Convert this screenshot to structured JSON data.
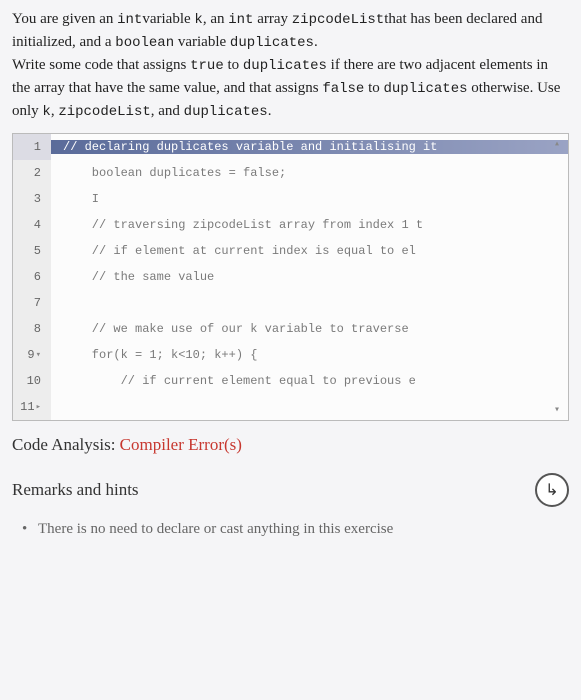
{
  "problem": {
    "sentence1_pre": "You are given an ",
    "sentence1_var1": "int",
    "sentence1_mid1": "variable ",
    "sentence1_var2": "k",
    "sentence1_mid2": ", an ",
    "sentence1_var3": "int",
    "sentence1_mid3": " array ",
    "sentence1_var4": "zipcodeList",
    "sentence1_mid4": "that has been declared and initialized, and a ",
    "sentence1_var5": "boolean",
    "sentence1_mid5": " variable ",
    "sentence1_var6": "duplicates",
    "sentence1_end": ".",
    "sentence2_pre": "Write some code that assigns ",
    "sentence2_var1": "true",
    "sentence2_mid1": " to ",
    "sentence2_var2": "duplicates",
    "sentence2_mid2": " if there are two adjacent elements in the array that have the same value, and that assigns ",
    "sentence2_var3": "false",
    "sentence2_mid3": " to ",
    "sentence2_var4": "duplicates",
    "sentence2_mid4": " otherwise. Use only ",
    "sentence2_var5": "k",
    "sentence2_mid5": ", ",
    "sentence2_var6": "zipcodeList",
    "sentence2_mid6": ", and ",
    "sentence2_var7": "duplicates",
    "sentence2_end": "."
  },
  "code": {
    "lines": [
      {
        "num": "1",
        "text": "// declaring duplicates variable and initialising it",
        "highlight": true,
        "collapse": ""
      },
      {
        "num": "2",
        "text": "    boolean duplicates = false;",
        "highlight": false,
        "collapse": ""
      },
      {
        "num": "3",
        "text": "    I",
        "highlight": false,
        "collapse": ""
      },
      {
        "num": "4",
        "text": "    // traversing zipcodeList array from index 1 t",
        "highlight": false,
        "collapse": ""
      },
      {
        "num": "5",
        "text": "    // if element at current index is equal to el",
        "highlight": false,
        "collapse": ""
      },
      {
        "num": "6",
        "text": "    // the same value",
        "highlight": false,
        "collapse": ""
      },
      {
        "num": "7",
        "text": "",
        "highlight": false,
        "collapse": ""
      },
      {
        "num": "8",
        "text": "    // we make use of our k variable to traverse",
        "highlight": false,
        "collapse": ""
      },
      {
        "num": "9",
        "text": "    for(k = 1; k<10; k++) {",
        "highlight": false,
        "collapse": "▾"
      },
      {
        "num": "10",
        "text": "        // if current element equal to previous e",
        "highlight": false,
        "collapse": ""
      },
      {
        "num": "11",
        "text": "",
        "highlight": false,
        "collapse": "▸"
      }
    ],
    "scroll_up": "▴",
    "scroll_down": "▾"
  },
  "analysis": {
    "label_prefix": "Code Analysis: ",
    "label_error": "Compiler Error(s)"
  },
  "remarks": {
    "title": "Remarks and hints",
    "toggle_icon": "↳",
    "hint1": "There is no need to declare or cast anything in this exercise"
  }
}
